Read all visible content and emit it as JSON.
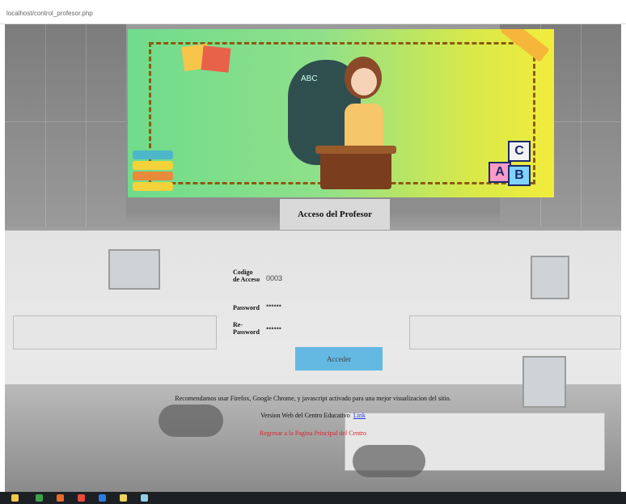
{
  "browser": {
    "address": "localhost/control_profesor.php"
  },
  "banner": {
    "note_text": "",
    "board_text": "ABC",
    "blocks": [
      "C",
      "A",
      "B"
    ]
  },
  "login": {
    "title": "Acceso del Profesor",
    "code_label": "Codigo de Acceso",
    "code_value": "0003",
    "password_label": "Password",
    "password_value": "••••••",
    "repassword_label": "Re-Password",
    "repassword_value": "••••••",
    "submit_label": "Acceder"
  },
  "footer": {
    "recommend_text": "Recomendamos usar Firefox, Google Chrome, y javascript activado para una mejor visualizacion del sitio.",
    "version_text": "Version Web del Centro Educativo",
    "link_text": "Link",
    "back_text": "Regresar a la Pagina Principal del Centro"
  },
  "colors": {
    "button": "#64b9e3",
    "back_link": "#d8262c",
    "link": "#2a3bd6"
  },
  "taskbar": {
    "icons": [
      "start-icon",
      "explorer-icon",
      "firefox-icon",
      "chrome-icon",
      "edge-icon",
      "files-icon",
      "app-icon"
    ]
  }
}
